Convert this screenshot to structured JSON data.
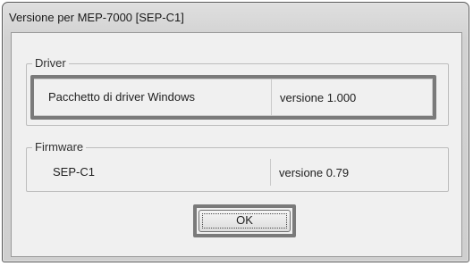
{
  "window": {
    "title": "Versione per MEP-7000 [SEP-C1]"
  },
  "driver_group": {
    "legend": "Driver",
    "row": {
      "name": "Pacchetto di driver Windows",
      "value": "versione 1.000"
    }
  },
  "firmware_group": {
    "legend": "Firmware",
    "row": {
      "name": "SEP-C1",
      "value": "versione 0.79"
    }
  },
  "buttons": {
    "ok_label": "OK"
  },
  "colors": {
    "highlight_border": "#7a7a7a",
    "dialog_background": "#f0f0f0",
    "titlebar": "#d6d6d6"
  }
}
